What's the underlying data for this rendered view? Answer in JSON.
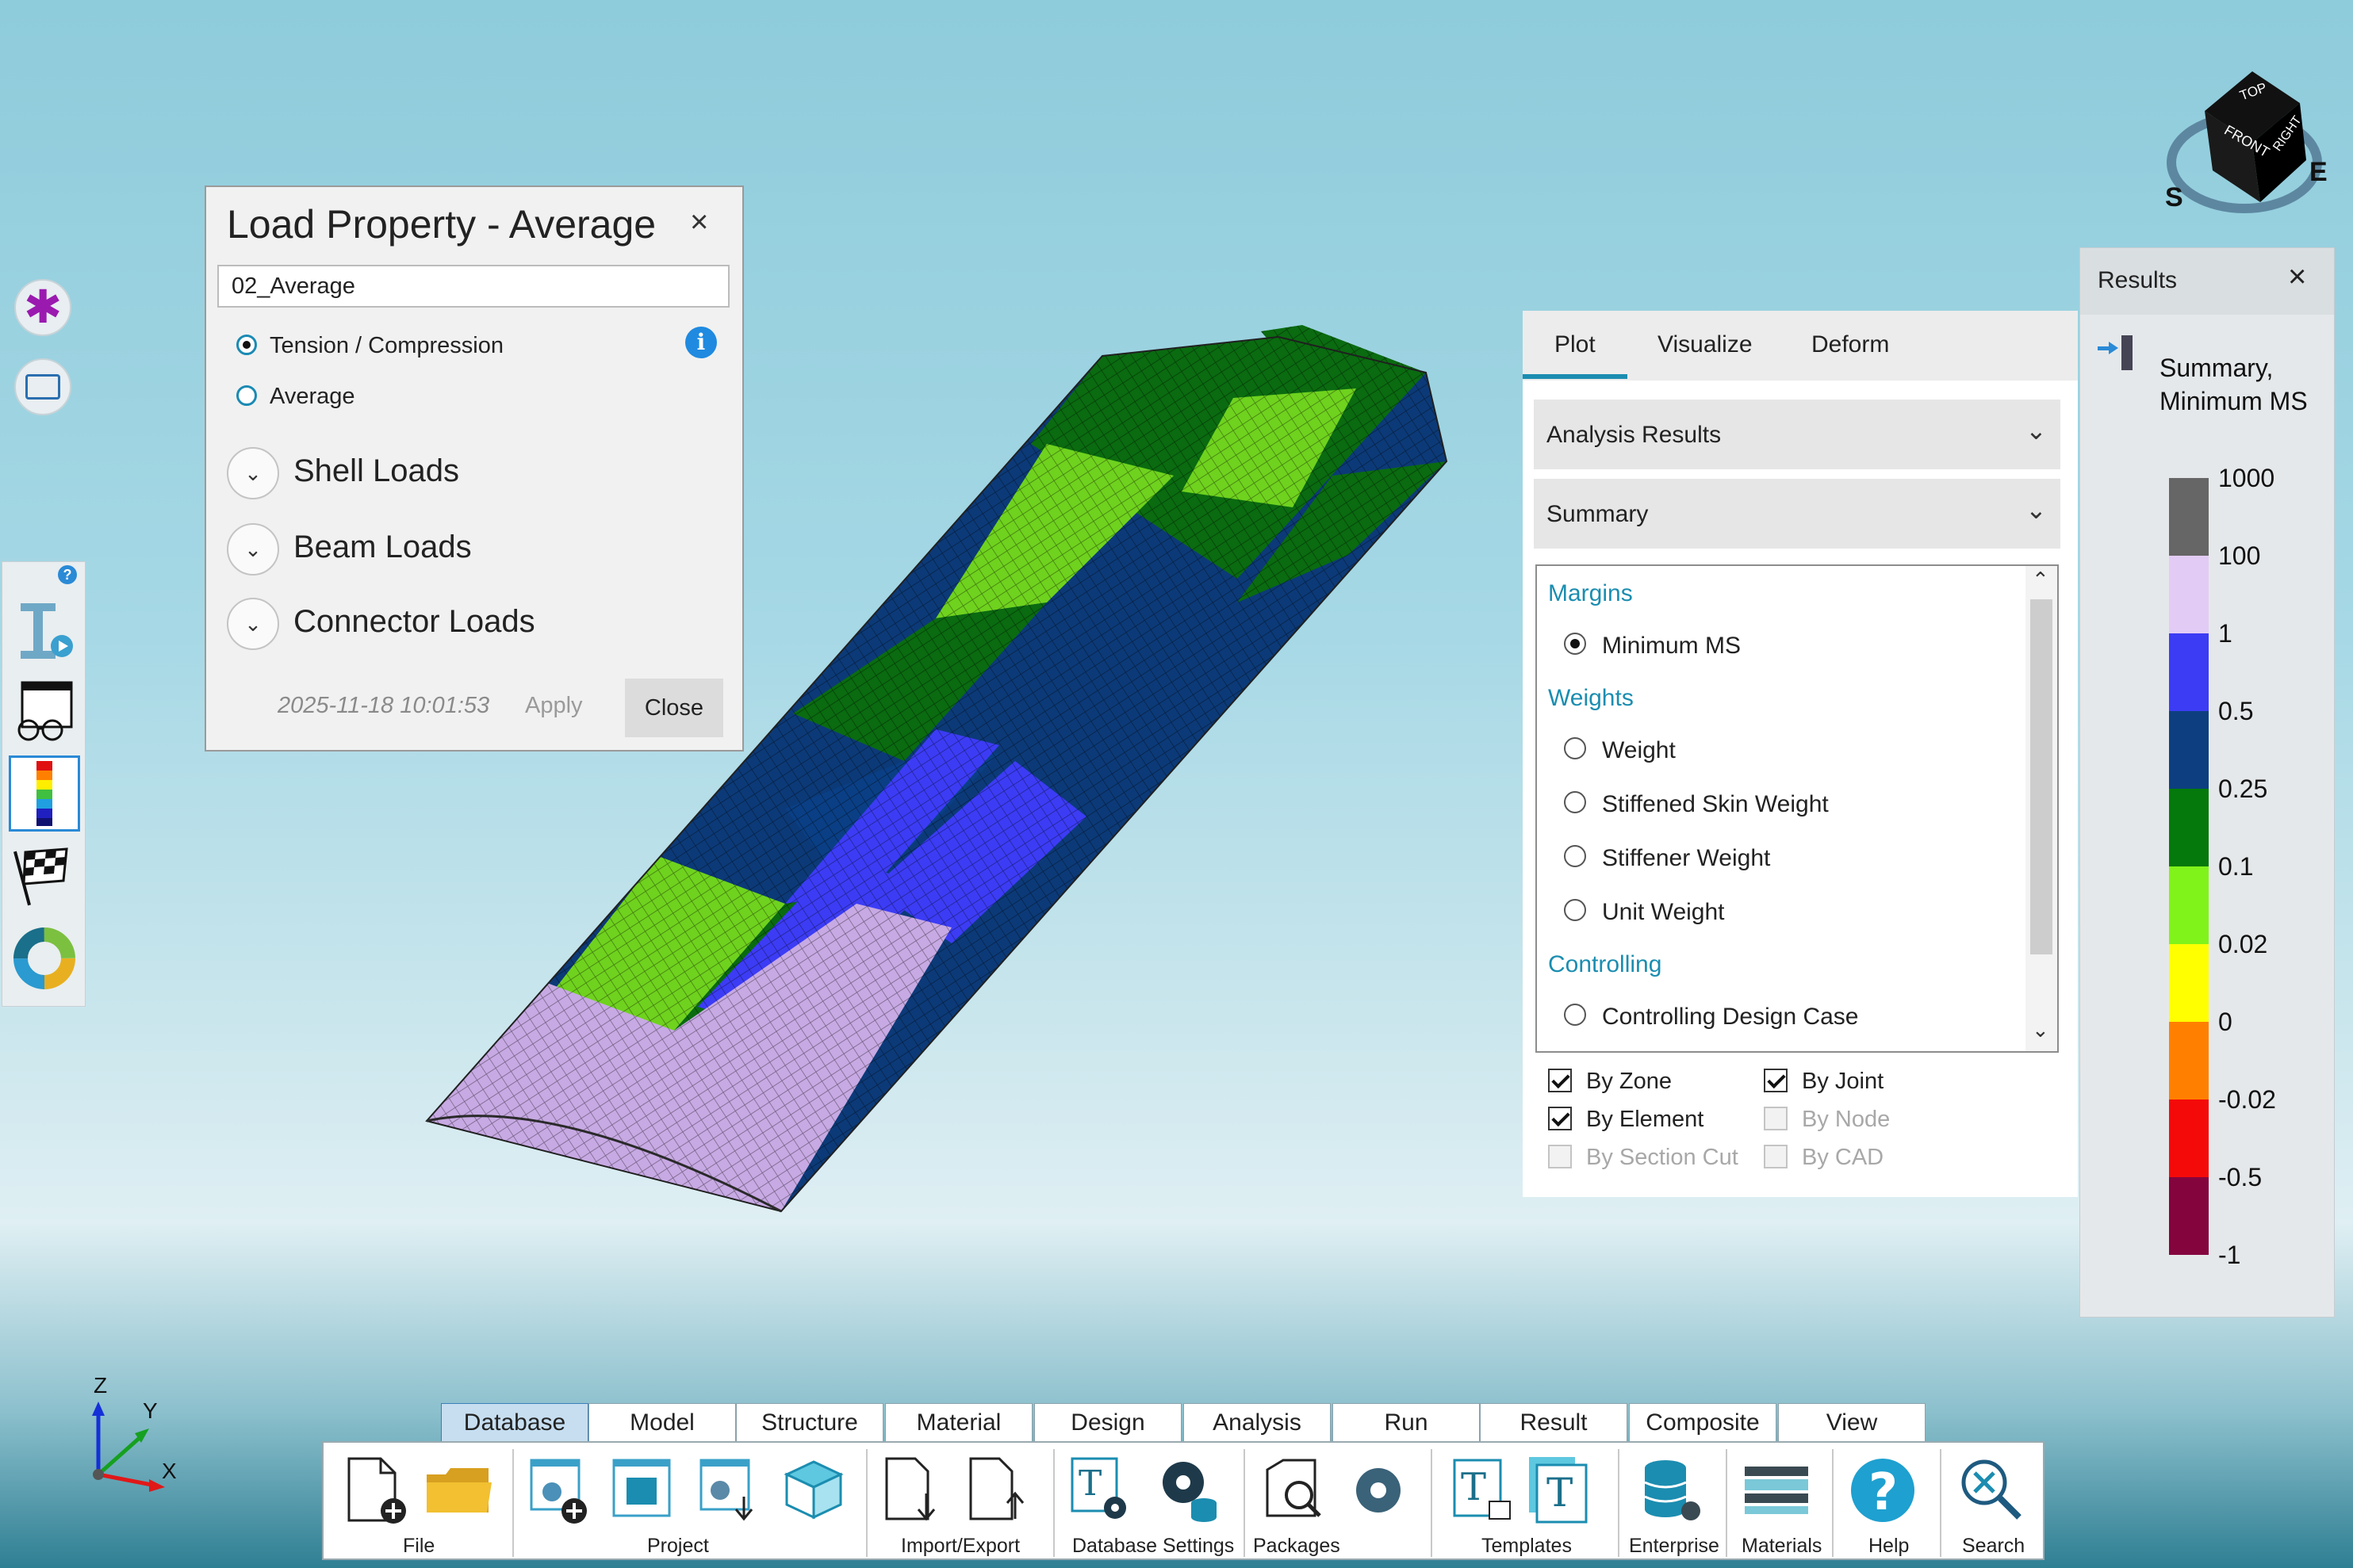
{
  "load_property_dialog": {
    "title": "Load Property - Average",
    "name_value": "02_Average",
    "options": [
      "Tension / Compression",
      "Average"
    ],
    "selected_option": "Tension / Compression",
    "sections": [
      "Shell Loads",
      "Beam Loads",
      "Connector Loads"
    ],
    "timestamp": "2025-11-18 10:01:53",
    "apply_label": "Apply",
    "close_label": "Close",
    "close_icon": "×"
  },
  "plot_panel": {
    "tabs": [
      "Plot",
      "Visualize",
      "Deform"
    ],
    "active_tab": "Plot",
    "dropdown_1": "Analysis Results",
    "dropdown_2": "Summary",
    "list": {
      "margins_header": "Margins",
      "margins_items": [
        "Minimum MS"
      ],
      "weights_header": "Weights",
      "weights_items": [
        "Weight",
        "Stiffened Skin Weight",
        "Stiffener Weight",
        "Unit Weight"
      ],
      "controlling_header": "Controlling",
      "controlling_items": [
        "Controlling Design Case"
      ],
      "selected": "Minimum MS"
    },
    "checkboxes": {
      "by_zone": "By Zone",
      "by_joint": "By Joint",
      "by_element": "By Element",
      "by_node": "By Node",
      "by_section_cut": "By Section Cut",
      "by_cad": "By CAD"
    }
  },
  "results_panel": {
    "title": "Results",
    "close_icon": "×",
    "subtitle": "Summary, Minimum MS",
    "legend": [
      {
        "label": "1000",
        "color": "#666666"
      },
      {
        "label": "100",
        "color": "#e2ccf6"
      },
      {
        "label": "1",
        "color": "#3c3cf5"
      },
      {
        "label": "0.5",
        "color": "#0d3f80"
      },
      {
        "label": "0.25",
        "color": "#05790b"
      },
      {
        "label": "0.1",
        "color": "#80f31a"
      },
      {
        "label": "0.02",
        "color": "#ffff00"
      },
      {
        "label": "0",
        "color": "#ff8000"
      },
      {
        "label": "-0.02",
        "color": "#f50a0a"
      },
      {
        "label": "-0.5",
        "color": "#84043e"
      },
      {
        "label": "-1",
        "color": ""
      }
    ]
  },
  "view_cube": {
    "top": "TOP",
    "front": "FRONT",
    "right": "RIGHT",
    "s": "S",
    "e": "E"
  },
  "axes": {
    "z": "Z",
    "y": "Y",
    "x": "X"
  },
  "info_icon": "i",
  "help_badge": "?",
  "ribbon": {
    "tabs": [
      "Database",
      "Model",
      "Structure",
      "Material",
      "Design",
      "Analysis",
      "Run",
      "Result",
      "Composite",
      "View"
    ],
    "active_tab": "Database",
    "groups": [
      "File",
      "Project",
      "Import/Export",
      "Database Settings",
      "Packages",
      "Templates",
      "Enterprise",
      "Materials",
      "Help",
      "Search"
    ]
  }
}
